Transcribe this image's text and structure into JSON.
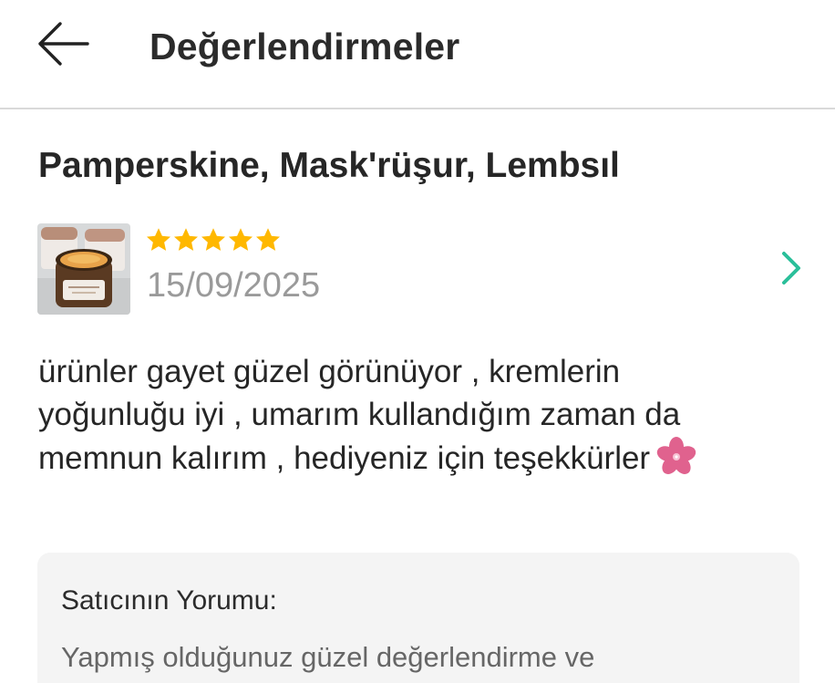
{
  "header": {
    "title": "Değerlendirmeler",
    "back_icon": "arrow-left-icon"
  },
  "product": {
    "title": "Pamperskine, Mask'rüşur, Lembsıl"
  },
  "review": {
    "rating": 5,
    "rating_max": 5,
    "star_color": "#ffb800",
    "date": "15/09/2025",
    "text": "ürünler gayet güzel görünüyor , kremlerin yoğunluğu iyi , umarım kullandığım zaman da memnun kalırım , hediyeniz için teşekkürler",
    "emoji_icon": "cherry-blossom-icon",
    "chevron_color": "#2bbf9a"
  },
  "seller_response": {
    "label": "Satıcının Yorumu:",
    "text": "Yapmış olduğunuz güzel değerlendirme ve"
  }
}
